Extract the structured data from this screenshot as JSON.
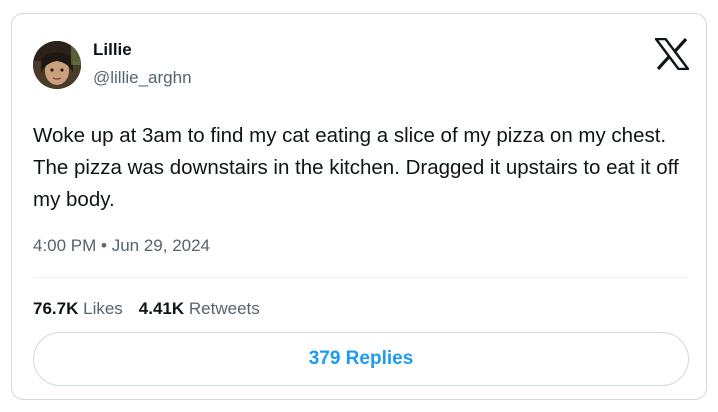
{
  "author": {
    "display_name": "Lillie",
    "handle": "@lillie_arghn"
  },
  "brand": {
    "logo_icon": "x-logo-icon",
    "accent_color": "#1d9bf0"
  },
  "tweet": {
    "text": "Woke up at 3am to find my cat eating a slice of my pizza on my chest. The pizza was downstairs in the kitchen. Dragged it upstairs to eat it off my body.",
    "timestamp": "4:00 PM • Jun 29, 2024"
  },
  "stats": {
    "likes_count": "76.7K",
    "likes_label": "Likes",
    "retweets_count": "4.41K",
    "retweets_label": "Retweets"
  },
  "replies_button": {
    "label": "379 Replies"
  }
}
